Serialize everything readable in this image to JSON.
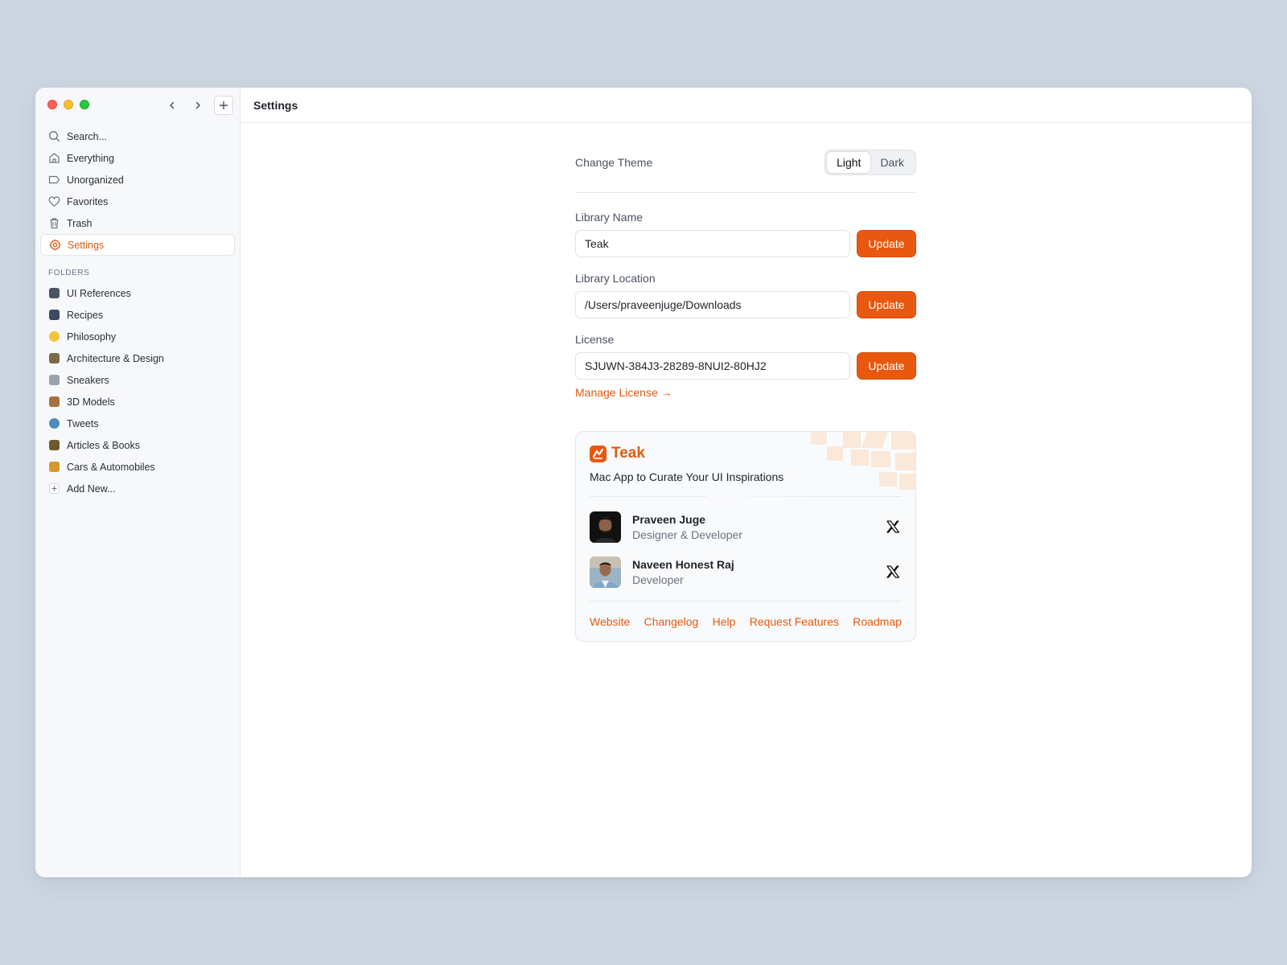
{
  "colors": {
    "accent": "#e8580f",
    "background": "#cdd6e1"
  },
  "sidebar": {
    "search": "Search...",
    "items": [
      {
        "label": "Everything",
        "icon": "home-icon"
      },
      {
        "label": "Unorganized",
        "icon": "tag-icon"
      },
      {
        "label": "Favorites",
        "icon": "heart-icon"
      },
      {
        "label": "Trash",
        "icon": "trash-icon"
      },
      {
        "label": "Settings",
        "icon": "gear-icon"
      }
    ],
    "folders_title": "FOLDERS",
    "folders": [
      {
        "label": "UI References",
        "color": "#4a5563"
      },
      {
        "label": "Recipes",
        "color": "#3b4a66"
      },
      {
        "label": "Philosophy",
        "color": "#f6c43b"
      },
      {
        "label": "Architecture & Design",
        "color": "#7a6a45"
      },
      {
        "label": "Sneakers",
        "color": "#9aa3ad"
      },
      {
        "label": "3D Models",
        "color": "#a8723d"
      },
      {
        "label": "Tweets",
        "color": "#4b8db8"
      },
      {
        "label": "Articles & Books",
        "color": "#6e5a2f"
      },
      {
        "label": "Cars & Automobiles",
        "color": "#d59a2c"
      }
    ],
    "add_new": "Add New..."
  },
  "header": {
    "title": "Settings"
  },
  "settings": {
    "theme_label": "Change Theme",
    "theme_light": "Light",
    "theme_dark": "Dark",
    "theme_selected": "Light",
    "library_name_label": "Library Name",
    "library_name_value": "Teak",
    "library_location_label": "Library Location",
    "library_location_value": "/Users/praveenjuge/Downloads",
    "license_label": "License",
    "license_value": "SJUWN-384J3-28289-8NUI2-80HJ2",
    "update_label": "Update",
    "manage_license": "Manage License →"
  },
  "about": {
    "brand": "Teak",
    "tagline": "Mac App to Curate Your UI Inspirations",
    "people": [
      {
        "name": "Praveen Juge",
        "role": "Designer & Developer"
      },
      {
        "name": "Naveen Honest Raj",
        "role": "Developer"
      }
    ],
    "links": [
      "Website",
      "Changelog",
      "Help",
      "Request Features",
      "Roadmap"
    ]
  }
}
